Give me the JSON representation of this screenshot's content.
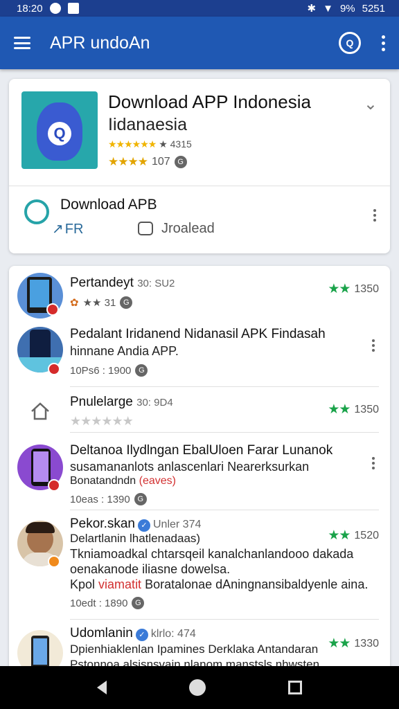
{
  "status_bar": {
    "time": "18:20",
    "battery": "9%",
    "clock_right": "5251"
  },
  "app_bar": {
    "title": "APR undoAn",
    "menu_icon": "hamburger-icon",
    "search_icon": "search-icon",
    "more_icon": "more-vert-icon"
  },
  "hero": {
    "title": "Download APP Indonesia",
    "subtitle": "Iidanaesia",
    "rating_stars": "★★★★★★",
    "rating_text": "★ 4315",
    "review_stars": "★★★★",
    "review_count": "107",
    "badge": "G",
    "download_label": "Download APB",
    "fr_label": "FR",
    "load_label": "Jroalead"
  },
  "list": [
    {
      "title": "Pertandeyt",
      "subtitle": "30: SU2",
      "meta": "★★ 31",
      "right_stars": "★★",
      "right_value": "1350"
    },
    {
      "title": "Pedalant Iridanend Nidanasil APK Findasah",
      "line2": "hinnane Andia APP.",
      "meta": "10Ps6 : 1900",
      "badge": "G"
    },
    {
      "title": "Pnulelarge",
      "subtitle": "30: 9D4",
      "stars_gray": "★★★★★★",
      "right_stars": "★★",
      "right_value": "1350"
    },
    {
      "title": "Deltanoa Ilydlngan Ebal​Uloen Farar Lunanok",
      "line2": "susamananlots anlascenlari Nearerksurkan",
      "line3_a": "Bonatandndn",
      "line3_b": "(eaves)",
      "meta": "10eas : 1390",
      "badge": "G"
    },
    {
      "title": "Pekor.skan",
      "sub": "Unler 374",
      "line2": "Delartlanin lhatlenadaas)",
      "line3": "Tkniamoadkal chtarsqeil kanalchanlandooo dakada",
      "line4": "oenakanode iliasne dowelsa.",
      "line5_a": "Kpol",
      "line5_b": "viamatit",
      "line5_c": "Boratalonae dAningnansibaldyenle aina.",
      "meta": "10edt : 1890",
      "badge": "G",
      "right_stars": "★★",
      "right_value": "1520"
    },
    {
      "title": "Udomlanin",
      "sub": "klrlo: 474",
      "line2": "Dpienhiaklenlan Ipamines Derklaka Antandaran",
      "line3": "Pstonnoa alsisnsvain nlanom manstsls nhwsten",
      "right_stars": "★★",
      "right_value": "1330"
    }
  ]
}
